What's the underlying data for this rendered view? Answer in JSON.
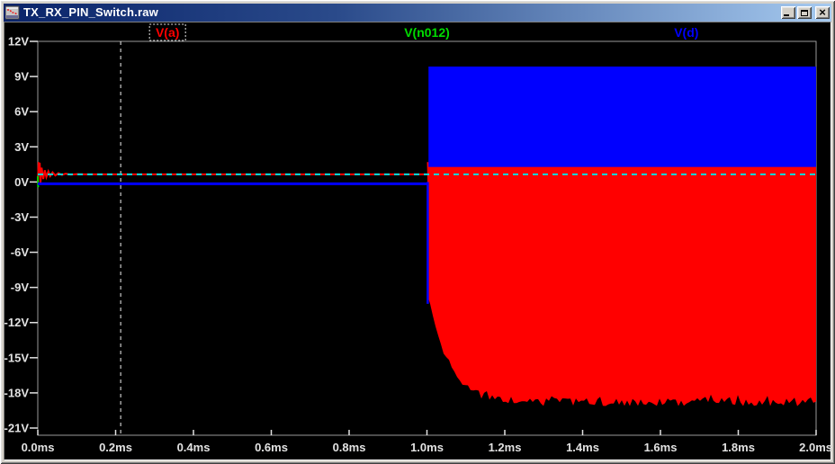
{
  "window": {
    "title": "TX_RX_PIN_Switch.raw",
    "controls": {
      "minimize": "minimize",
      "maximize": "maximize",
      "close": "close"
    }
  },
  "icons": {
    "close_glyph": "×"
  },
  "theme": {
    "titlebar_gradient_left": "#0a246a",
    "titlebar_gradient_right": "#a6caf0",
    "chrome_gray": "#d4d0c8",
    "plot_background": "#000000",
    "frame_color": "#9a9a9a",
    "tick_text_color": "#e2e2e2",
    "cursor_vertical_color": "#f2f2f2",
    "cursor_horizontal_color": "#00dede"
  },
  "chart_data": {
    "type": "line",
    "title": "",
    "grid": false,
    "legend_position": "top",
    "x_axis": {
      "unit": "ms",
      "min": 0,
      "max": 2,
      "tick_values": [
        0.0,
        0.2,
        0.4,
        0.6,
        0.8,
        1.0,
        1.2,
        1.4,
        1.6,
        1.8,
        2.0
      ],
      "tick_labels": [
        "0.0ms",
        "0.2ms",
        "0.4ms",
        "0.6ms",
        "0.8ms",
        "1.0ms",
        "1.2ms",
        "1.4ms",
        "1.6ms",
        "1.8ms",
        "2.0ms"
      ]
    },
    "y_axis": {
      "unit": "V",
      "min": -21,
      "max": 12,
      "tick_values": [
        12,
        9,
        6,
        3,
        0,
        -3,
        -6,
        -9,
        -12,
        -15,
        -18,
        -21
      ],
      "tick_labels": [
        "12V",
        "9V",
        "6V",
        "3V",
        "0V",
        "-3V",
        "-6V",
        "-9V",
        "-12V",
        "-15V",
        "-18V",
        "-21V"
      ]
    },
    "cursor": {
      "time_ms": 0.213,
      "value_v": 0.65
    },
    "series": [
      {
        "name": "V(a)",
        "color": "#ff0000",
        "selected": true,
        "description": "startup ringing settling to ~0.65V, then dense RF oscillation after 1.0ms whose negative envelope decays from ~-10V to ~-18.8V",
        "points_ms_v": [
          [
            0.0,
            0.0
          ],
          [
            0.002,
            1.62
          ],
          [
            0.005,
            1.58
          ],
          [
            0.007,
            -0.05
          ],
          [
            0.01,
            1.22
          ],
          [
            0.014,
            0.25
          ],
          [
            0.018,
            1.0
          ],
          [
            0.022,
            0.42
          ],
          [
            0.027,
            0.9
          ],
          [
            0.032,
            0.5
          ],
          [
            0.038,
            0.82
          ],
          [
            0.045,
            0.55
          ],
          [
            0.053,
            0.75
          ],
          [
            0.062,
            0.6
          ],
          [
            0.072,
            0.71
          ],
          [
            0.085,
            0.62
          ],
          [
            0.1,
            0.67
          ],
          [
            0.12,
            0.65
          ],
          [
            1.0,
            0.65
          ]
        ],
        "oscillation_fill": {
          "t_start_ms": 1.0,
          "t_end_ms": 2.0,
          "top_v": 1.7,
          "bottom_start_v": -9.8,
          "bottom_end_v": -18.8,
          "decay_tau_ms": 0.051,
          "bottom_noise_v": 0.35
        }
      },
      {
        "name": "V(n012)",
        "color": "#00dc00",
        "selected": false,
        "description": "only a short vertical sliver visible at t=0; elsewhere hidden under other traces",
        "points_ms_v": [
          [
            0.0,
            0.5
          ],
          [
            0.001,
            -0.45
          ]
        ]
      },
      {
        "name": "V(d)",
        "color": "#0000ff",
        "selected": false,
        "description": "0V until 1.0ms, brief spike to ~-10.4V, then dense oscillation between ~+1.3V and ~+9.9V",
        "flat_v": 0,
        "flat_until_ms": 1.0,
        "spike_ms_v": [
          1.002,
          -10.4
        ],
        "oscillation_fill": {
          "t_start_ms": 1.004,
          "t_end_ms": 2.0,
          "top_v": 9.85,
          "bottom_v": 1.28
        }
      }
    ]
  }
}
